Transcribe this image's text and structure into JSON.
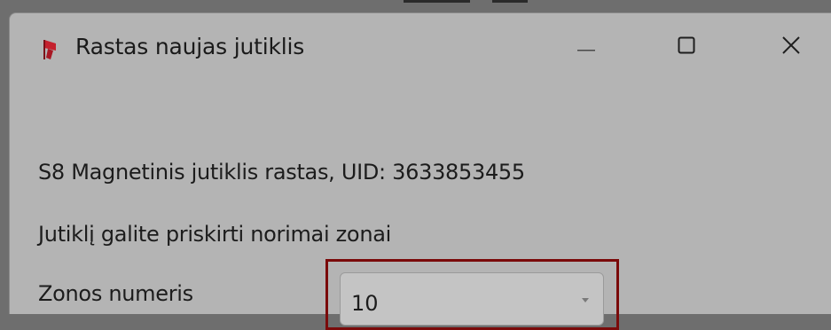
{
  "window": {
    "title": "Rastas naujas jutiklis",
    "icon": "red-flag-app-icon"
  },
  "title_buttons": {
    "minimize_icon": "minimize-icon",
    "maximize_icon": "maximize-icon",
    "close_icon": "close-icon"
  },
  "content": {
    "found_message": "S8 Magnetinis jutiklis rastas, UID: 3633853455",
    "assign_message": "Jutiklį galite priskirti norimai zonai",
    "zone_label": "Zonos numeris",
    "zone_value": "10"
  },
  "colors": {
    "highlight": "#7a0a0a",
    "icon_red": "#c4212e"
  }
}
